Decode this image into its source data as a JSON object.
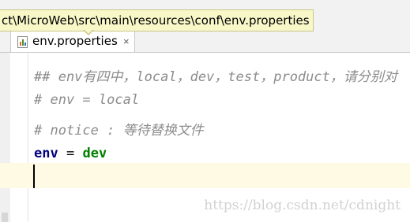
{
  "tooltip": {
    "path": "ct\\MicroWeb\\src\\main\\resources\\conf\\env.properties"
  },
  "tab": {
    "filename": "env.properties",
    "close_glyph": "×",
    "icon": "properties-file-icon"
  },
  "editor": {
    "lines": [
      {
        "text": "## env有四中，local，dev，test，product，请分别对",
        "type": "comment"
      },
      {
        "text": "# env = local",
        "type": "comment"
      },
      {
        "text": "# notice : 等待替换文件",
        "type": "comment"
      },
      {
        "key": "env",
        "operator": "=",
        "value": "dev",
        "type": "property"
      }
    ]
  },
  "watermark": "https://blog.csdn.net/cdnight",
  "colors": {
    "comment": "#8c8c8c",
    "key": "#000080",
    "value": "#008000",
    "current_line": "#fffae3",
    "tooltip_bg": "#f7f7c8"
  }
}
